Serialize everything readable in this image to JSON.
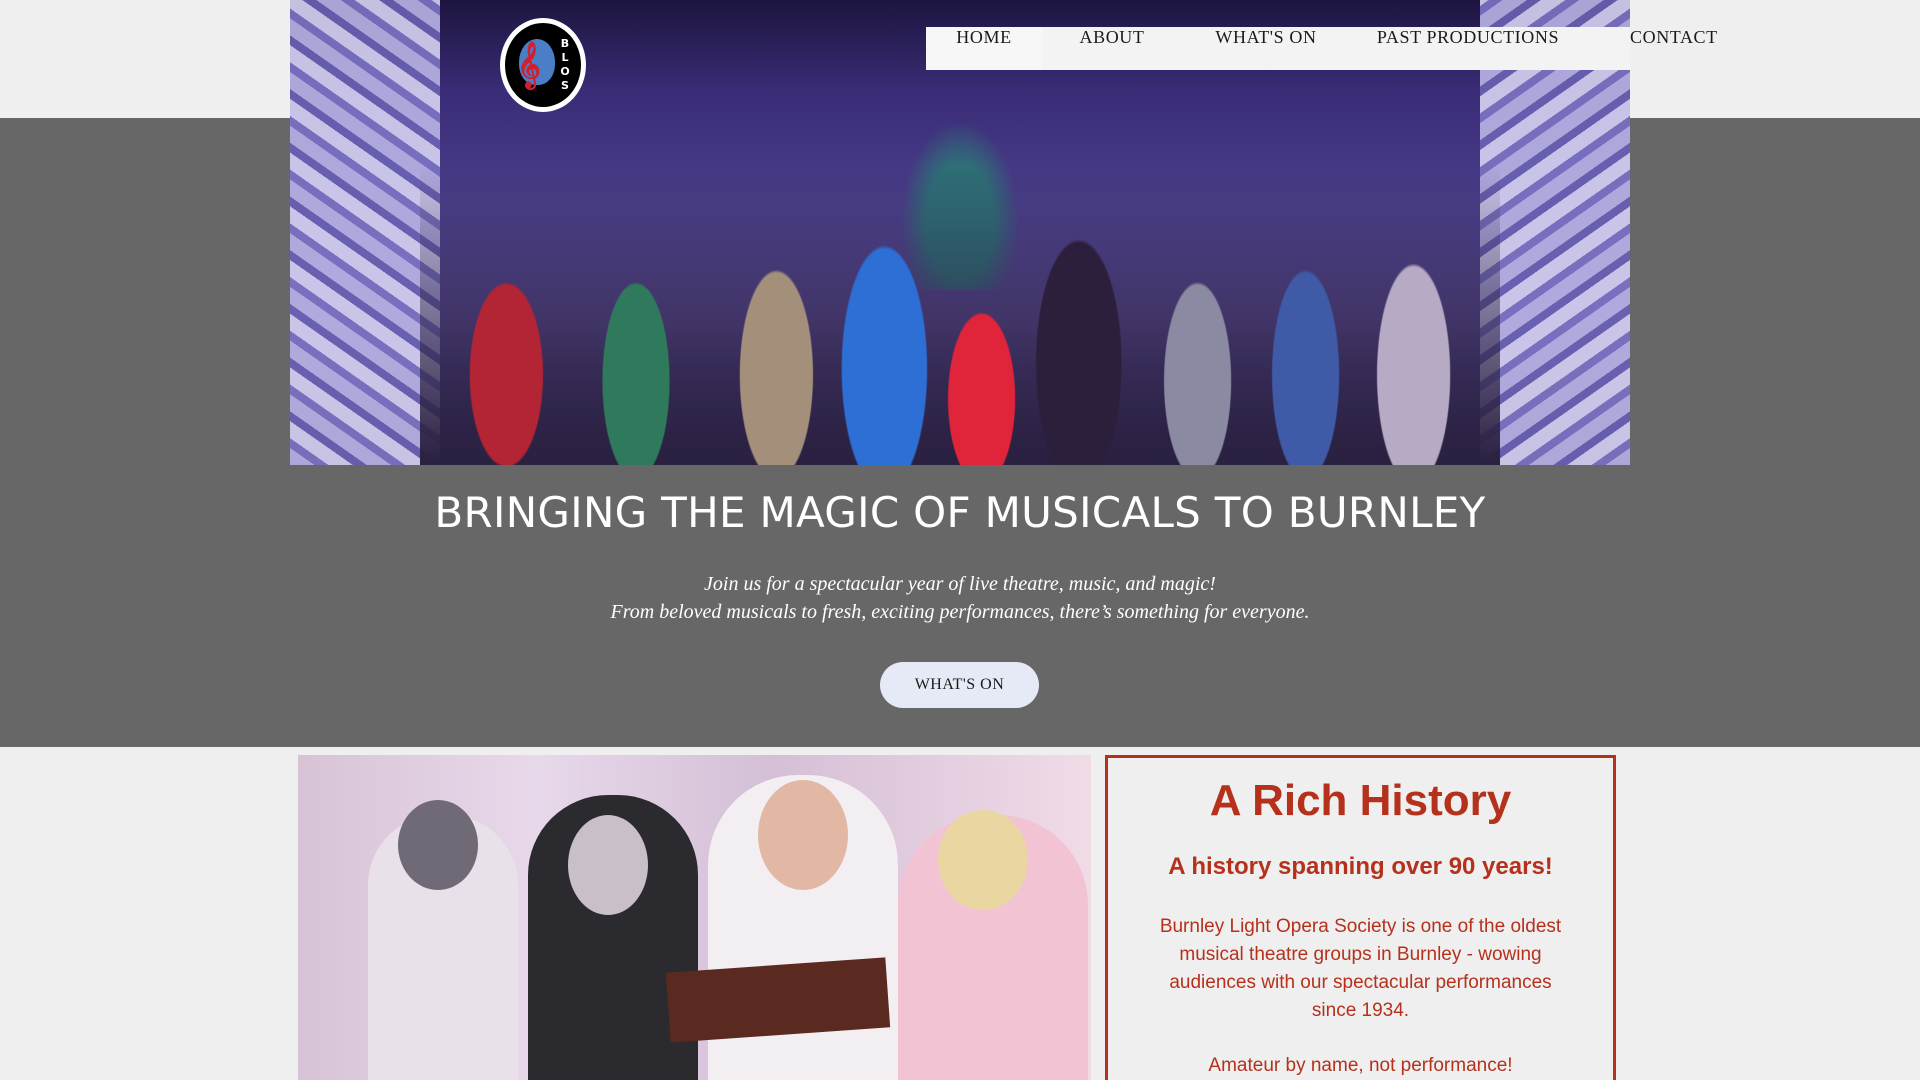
{
  "brand": {
    "logo_letters": "B L O S"
  },
  "nav": {
    "items": [
      {
        "label": "HOME"
      },
      {
        "label": "ABOUT"
      },
      {
        "label": "WHAT'S ON"
      },
      {
        "label": "PAST PRODUCTIONS"
      },
      {
        "label": "CONTACT"
      }
    ]
  },
  "hero": {
    "title": "BRINGING THE MAGIC OF MUSICALS TO BURNLEY",
    "subtitle_line1": "Join us for a spectacular year of live theatre, music, and magic!",
    "subtitle_line2": "From beloved musicals to fresh, exciting performances, there’s something for everyone.",
    "cta_label": "WHAT'S ON"
  },
  "history": {
    "title": "A Rich History",
    "subtitle": "A history spanning over 90 years!",
    "body": "Burnley Light Opera Society is one of the oldest musical theatre groups in Burnley - wowing audiences with our spectacular performances since 1934.",
    "tagline": "Amateur by name, not performance!"
  },
  "colors": {
    "hero_bg": "#676767",
    "accent": "#b5311c",
    "cta_bg": "#e6eaf7"
  }
}
